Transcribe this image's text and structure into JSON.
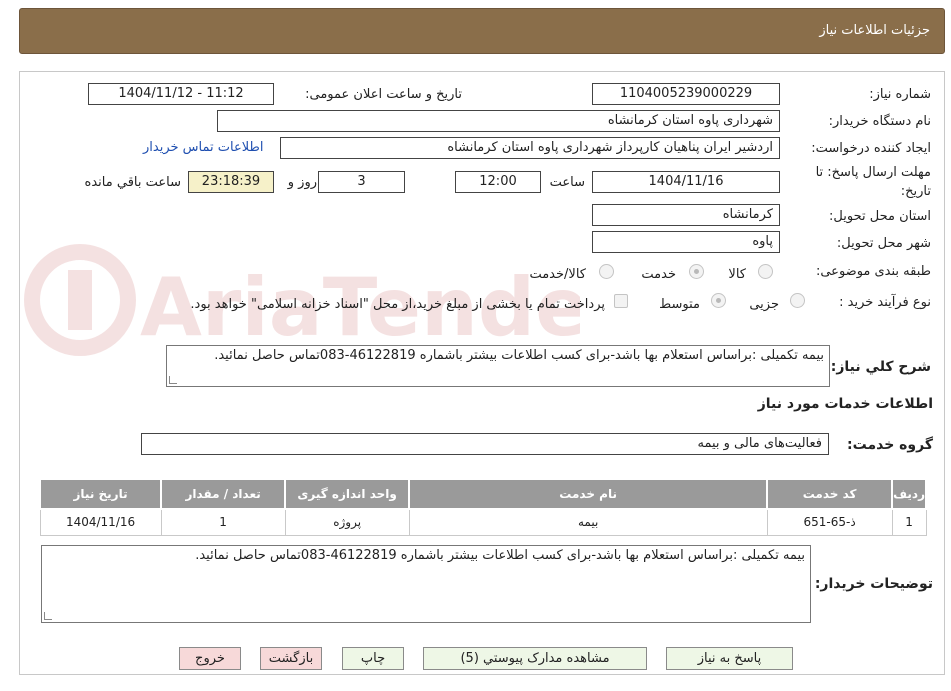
{
  "header": {
    "title": "جزئیات اطلاعات نیاز"
  },
  "fields": {
    "need_number_label": "شماره نیاز:",
    "need_number": "1104005239000229",
    "announce_label": "تاریخ و ساعت اعلان عمومی:",
    "announce_value": "1404/11/12 - 11:12",
    "buyer_org_label": "نام دستگاه خریدار:",
    "buyer_org": "شهرداری پاوه استان کرمانشاه",
    "creator_label": "ایجاد کننده درخواست:",
    "creator": "اردشیر ایران پناهیان کارپرداز شهرداری پاوه استان کرمانشاه",
    "contact_link": "اطلاعات تماس خریدار",
    "deadline_label_1": "مهلت ارسال پاسخ: تا",
    "deadline_label_2": "تاریخ:",
    "deadline_date": "1404/11/16",
    "time_label": "ساعت",
    "deadline_time": "12:00",
    "days": "3",
    "days_label": "روز و",
    "remaining": "23:18:39",
    "remaining_label": "ساعت باقي مانده",
    "province_label": "استان محل تحویل:",
    "province": "کرمانشاه",
    "city_label": "شهر محل تحویل:",
    "city": "پاوه",
    "category_label": "طبقه بندی موضوعی:",
    "category_options": [
      "کالا",
      "خدمت",
      "کالا/خدمت"
    ],
    "process_label": "نوع فرآیند خرید :",
    "process_options": [
      "جزیی",
      "متوسط"
    ],
    "payment_note": "پرداخت تمام یا بخشی از مبلغ خرید،از محل \"اسناد خزانه اسلامی\" خواهد بود.",
    "summary_label": "شرح کلي نياز:",
    "summary": "بیمه تکمیلی :براساس استعلام بها باشد-برای کسب اطلاعات بیشتر باشماره 46122819-083تماس حاصل نمائید.",
    "services_title": "اطلاعات خدمات مورد نياز",
    "service_group_label": "گروه خدمت:",
    "service_group": "فعالیت‌های مالی و بیمه"
  },
  "table": {
    "headers": [
      "ردیف",
      "کد خدمت",
      "نام خدمت",
      "واحد اندازه گیری",
      "تعداد / مقدار",
      "تاریخ نیاز"
    ],
    "rows": [
      [
        "1",
        "ذ-65-651",
        "بیمه",
        "پروژه",
        "1",
        "1404/11/16"
      ]
    ]
  },
  "buyer_notes_label": "توضیحات خریدار:",
  "buyer_notes": "بیمه تکمیلی :براساس استعلام بها باشد-برای کسب اطلاعات بیشتر باشماره 46122819-083تماس حاصل نمائید.",
  "buttons": {
    "reply": "پاسخ به نیاز",
    "attachments": "مشاهده مدارک پیوستي (5)",
    "print": "چاپ",
    "back": "بازگشت",
    "exit": "خروج"
  },
  "watermark": "AriaTender.neT",
  "colors": {
    "header": "#8a6e4a",
    "link": "#1f4fb0",
    "table_header": "#9a9a9a"
  }
}
